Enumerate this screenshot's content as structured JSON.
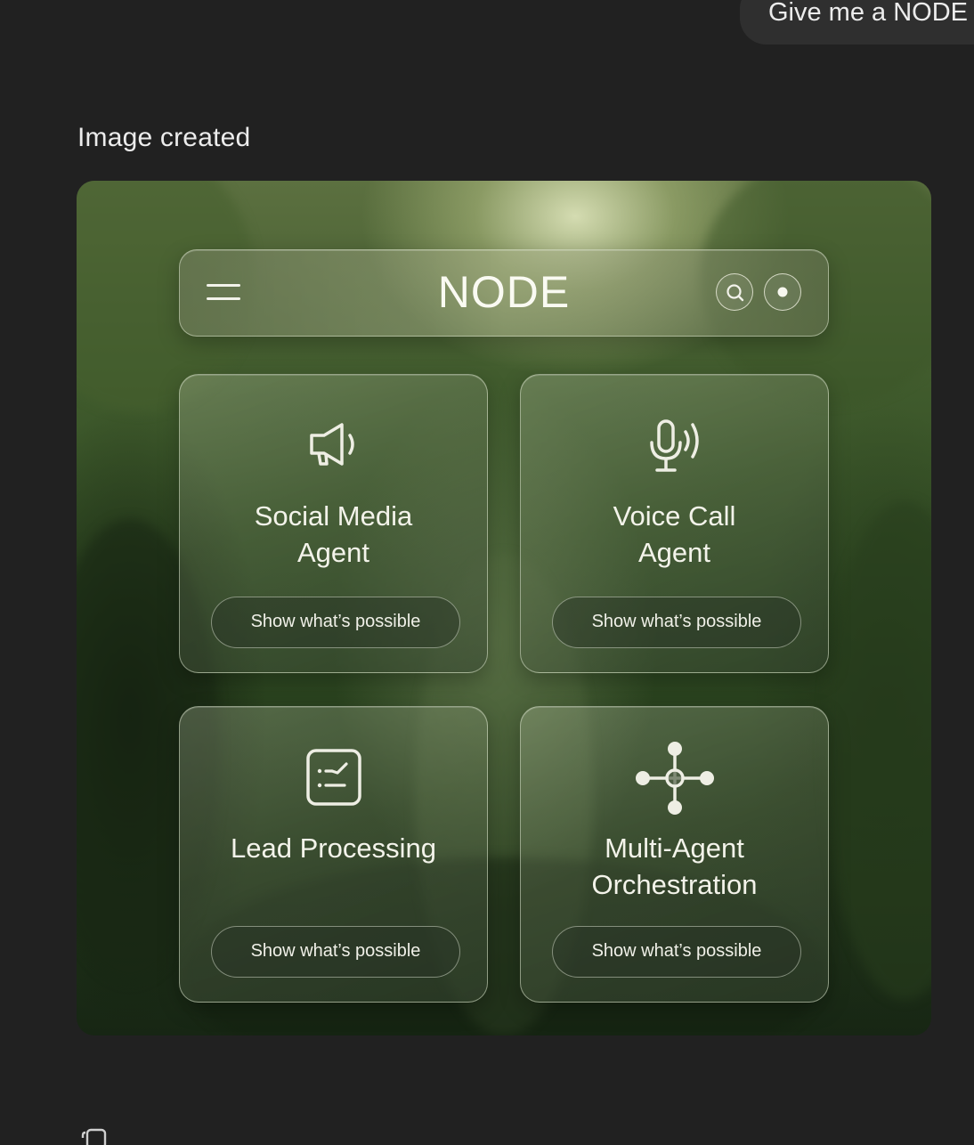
{
  "chat": {
    "user_message": "Give me a NODE",
    "status_text": "Image created"
  },
  "app": {
    "brand": "NODE",
    "topbar_icons": [
      "menu-icon",
      "search-icon",
      "record-dot-icon"
    ]
  },
  "tiles": [
    {
      "icon": "megaphone-icon",
      "title_line1": "Social Media",
      "title_line2": "Agent",
      "button": "Show what’s possible"
    },
    {
      "icon": "microphone-icon",
      "title_line1": "Voice Call",
      "title_line2": "Agent",
      "button": "Show what’s possible"
    },
    {
      "icon": "checklist-icon",
      "title_line1": "Lead Processing",
      "title_line2": "",
      "button": "Show what’s possible"
    },
    {
      "icon": "network-nodes-icon",
      "title_line1": "Multi-Agent",
      "title_line2": "Orchestration",
      "button": "Show what’s possible"
    }
  ],
  "colors": {
    "page_background": "#212121",
    "text": "#ececec",
    "forest_green": "#2f4a22"
  },
  "footer_icons": [
    "copy-icon"
  ]
}
